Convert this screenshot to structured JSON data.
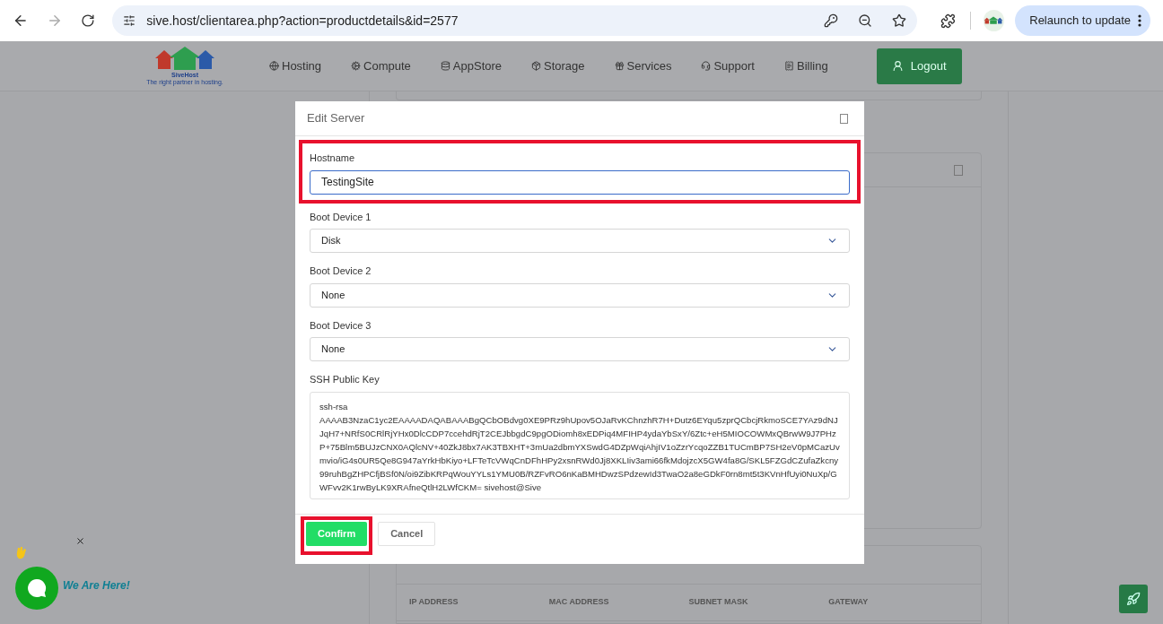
{
  "browser": {
    "url": "sive.host/clientarea.php?action=productdetails&id=2577",
    "relaunch": "Relaunch to update"
  },
  "nav": {
    "brand": "SiveHost",
    "tagline": "The right partner in hosting.",
    "items": [
      {
        "kind": "globe",
        "label": "Hosting"
      },
      {
        "kind": "cog",
        "label": "Compute"
      },
      {
        "kind": "database",
        "label": "AppStore"
      },
      {
        "kind": "box",
        "label": "Storage"
      },
      {
        "kind": "gift",
        "label": "Services"
      },
      {
        "kind": "headset",
        "label": "Support"
      },
      {
        "kind": "receipt",
        "label": "Billing"
      }
    ],
    "logout": "Logout"
  },
  "background": {
    "table_columns": [
      "IP ADDRESS",
      "MAC ADDRESS",
      "SUBNET MASK",
      "GATEWAY"
    ]
  },
  "modal": {
    "title": "Edit Server",
    "fields": [
      {
        "kind": "text",
        "label": "Hostname",
        "value": "TestingSite",
        "highlighted": true
      },
      {
        "kind": "select",
        "label": "Boot Device 1",
        "value": "Disk",
        "highlighted": false
      },
      {
        "kind": "select",
        "label": "Boot Device 2",
        "value": "None",
        "highlighted": false
      },
      {
        "kind": "select",
        "label": "Boot Device 3",
        "value": "None",
        "highlighted": false
      },
      {
        "kind": "textarea",
        "label": "SSH Public Key",
        "value": "ssh-rsa AAAAB3NzaC1yc2EAAAADAQABAAABgQCbOBdvg0XE9PRz9hUpov5OJaRvKChnzhR7H+Dutz6EYqu5zprQCbcjRkmoSCE7YAz9dNJJqH7+NRfS0CRlRjYHx0DlcCDP7ccehdRjT2CEJbbgdC9pgODiomh8xEDPiq4MFIHP4ydaYbSxY/6Ztc+eH5MIOCOWMxQBrwW9J7PHzP+75Blm5BUJzCNX0AQlcNV+40ZkJ8bx7AK3TBXHT+3mUa2dbmYXSwdG4DZpWqiAhjIV1oZzrYcqoZZB1TUCmBP7SH2eV0pMCazUvmvio/iG4s0UR5Qe8G947aYrkHbKiyo+LFTeTcVWqCnDFhHPy2xsnRWd0Jj8XKLIiv3ami66fkMdojzcX5GW4fa8G/SKL5FZGdCZufaZkcny99ruhBgZHPCfjBSf0N/oi9ZibKRPqWouYYLs1YMU0B/RZFvRO6nKaBMHDwzSPdzewId3TwaO2a8eGDkF0rn8mt5t3KVnHfUyi0NuXp/GWFvv2K1rwByLK9XRAfneQtlH2LWfCKM= sivehost@Sive",
        "highlighted": false
      }
    ],
    "buttons": [
      {
        "kind": "primary",
        "label": "Confirm",
        "highlighted": true
      },
      {
        "kind": "secondary",
        "label": "Cancel",
        "highlighted": false
      }
    ]
  },
  "chat": {
    "greeting": "We Are Here!"
  }
}
